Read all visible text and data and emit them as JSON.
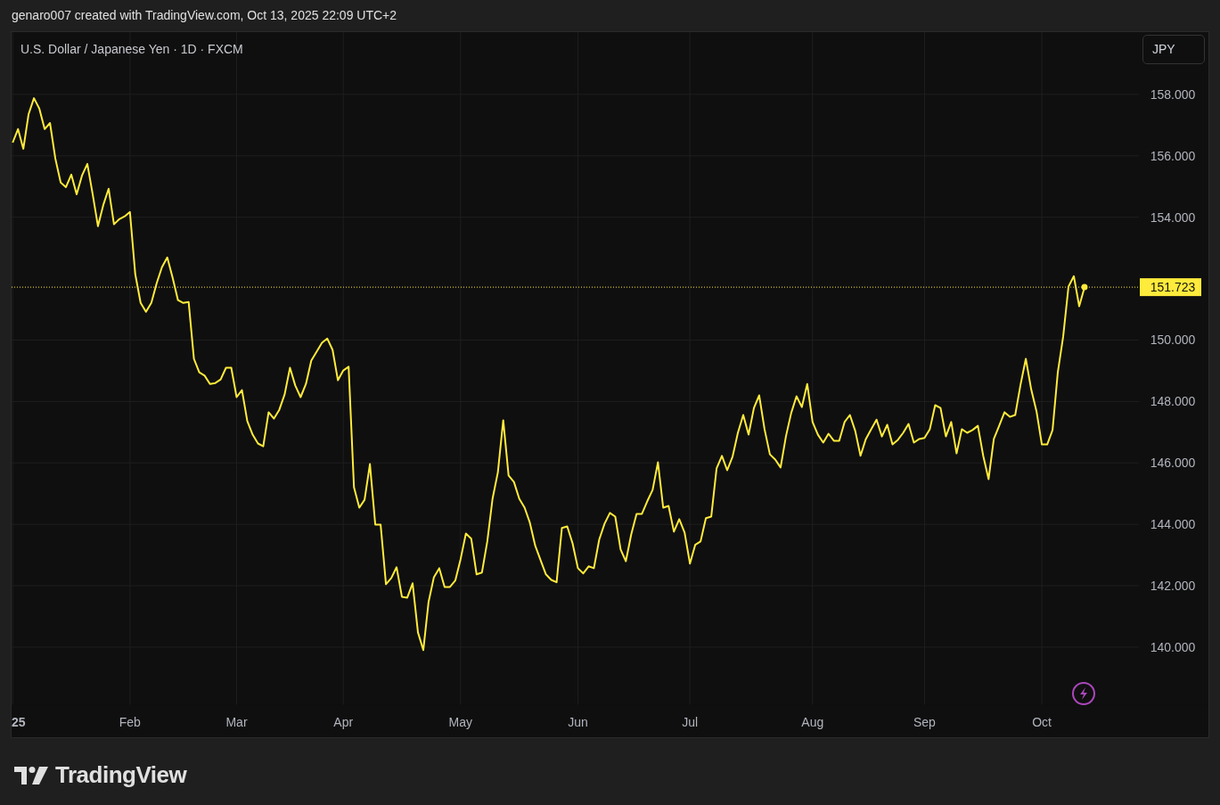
{
  "header": {
    "caption": "genaro007 created with TradingView.com, Oct 13, 2025 22:09 UTC+2"
  },
  "chart": {
    "symbol_title": "U.S. Dollar / Japanese Yen · 1D · FXCM",
    "currency_button": "JPY",
    "chart_data": {
      "type": "line",
      "grid": true,
      "ylim": [
        138.11,
        160.03
      ],
      "categories": [
        "25",
        null,
        null,
        null,
        null,
        null,
        null,
        null,
        null,
        null,
        null,
        null,
        null,
        null,
        null,
        null,
        null,
        null,
        null,
        null,
        null,
        null,
        "Feb",
        null,
        null,
        null,
        null,
        null,
        null,
        null,
        null,
        null,
        null,
        null,
        null,
        null,
        null,
        null,
        null,
        null,
        null,
        null,
        "Mar",
        null,
        null,
        null,
        null,
        null,
        null,
        null,
        null,
        null,
        null,
        null,
        null,
        null,
        null,
        null,
        null,
        null,
        null,
        null,
        "Apr",
        null,
        null,
        null,
        null,
        null,
        null,
        null,
        null,
        null,
        null,
        null,
        null,
        null,
        null,
        null,
        null,
        null,
        null,
        null,
        null,
        null,
        "May",
        null,
        null,
        null,
        null,
        null,
        null,
        null,
        null,
        null,
        null,
        null,
        null,
        null,
        null,
        null,
        null,
        null,
        null,
        null,
        null,
        null,
        "Jun",
        null,
        null,
        null,
        null,
        null,
        null,
        null,
        null,
        null,
        null,
        null,
        null,
        null,
        null,
        null,
        null,
        null,
        null,
        null,
        null,
        "Jul",
        null,
        null,
        null,
        null,
        null,
        null,
        null,
        null,
        null,
        null,
        null,
        null,
        null,
        null,
        null,
        null,
        null,
        null,
        null,
        null,
        null,
        null,
        "Aug",
        null,
        null,
        null,
        null,
        null,
        null,
        null,
        null,
        null,
        null,
        null,
        null,
        null,
        null,
        null,
        null,
        null,
        null,
        null,
        null,
        "Sep",
        null,
        null,
        null,
        null,
        null,
        null,
        null,
        null,
        null,
        null,
        null,
        null,
        null,
        null,
        null,
        null,
        null,
        null,
        null,
        null,
        null,
        "Oct",
        null,
        null,
        null,
        null,
        null,
        null,
        null,
        null
      ],
      "yticks": [
        {
          "value": 140,
          "label": "140.000"
        },
        {
          "value": 142,
          "label": "142.000"
        },
        {
          "value": 144,
          "label": "144.000"
        },
        {
          "value": 146,
          "label": "146.000"
        },
        {
          "value": 148,
          "label": "148.000"
        },
        {
          "value": 150,
          "label": "150.000"
        },
        {
          "value": 154,
          "label": "154.000"
        },
        {
          "value": 156,
          "label": "156.000"
        },
        {
          "value": 158,
          "label": "158.000"
        }
      ],
      "series": [
        {
          "color": "#ffeb3b",
          "values": [
            156.43,
            156.87,
            156.23,
            157.36,
            157.88,
            157.54,
            156.87,
            157.07,
            155.91,
            155.13,
            154.98,
            155.39,
            154.75,
            155.36,
            155.74,
            154.75,
            153.71,
            154.4,
            154.93,
            153.77,
            153.94,
            154.03,
            154.17,
            152.14,
            151.21,
            150.92,
            151.21,
            151.85,
            152.37,
            152.69,
            152.03,
            151.3,
            151.21,
            151.24,
            149.39,
            148.95,
            148.84,
            148.57,
            148.6,
            148.72,
            149.1,
            149.1,
            148.14,
            148.37,
            147.36,
            146.92,
            146.63,
            146.54,
            147.65,
            147.44,
            147.73,
            148.23,
            149.1,
            148.52,
            148.14,
            148.57,
            149.33,
            149.62,
            149.91,
            150.05,
            149.68,
            148.69,
            149.01,
            149.13,
            145.21,
            144.54,
            144.8,
            145.96,
            143.99,
            143.99,
            142.05,
            142.25,
            142.6,
            141.64,
            141.61,
            142.08,
            140.48,
            139.9,
            141.47,
            142.28,
            142.57,
            141.96,
            141.96,
            142.17,
            142.86,
            143.7,
            143.53,
            142.37,
            142.43,
            143.44,
            144.83,
            145.7,
            147.39,
            145.59,
            145.38,
            144.83,
            144.54,
            144.05,
            143.3,
            142.83,
            142.37,
            142.19,
            142.11,
            143.88,
            143.93,
            143.38,
            142.57,
            142.4,
            142.63,
            142.57,
            143.5,
            144.02,
            144.37,
            144.25,
            143.18,
            142.8,
            143.67,
            144.34,
            144.34,
            144.75,
            145.12,
            146.02,
            144.54,
            144.6,
            143.76,
            144.17,
            143.73,
            142.72,
            143.33,
            143.44,
            144.2,
            144.25,
            145.82,
            146.23,
            145.76,
            146.2,
            146.98,
            147.56,
            146.92,
            147.79,
            148.2,
            147.1,
            146.28,
            146.11,
            145.85,
            146.86,
            147.62,
            148.17,
            147.82,
            148.57,
            147.33,
            146.92,
            146.66,
            146.95,
            146.72,
            146.72,
            147.33,
            147.56,
            147.04,
            146.23,
            146.78,
            147.1,
            147.41,
            146.86,
            147.24,
            146.6,
            146.75,
            146.98,
            147.27,
            146.66,
            146.78,
            146.81,
            147.1,
            147.88,
            147.79,
            146.86,
            147.33,
            146.31,
            147.1,
            146.98,
            147.07,
            147.21,
            146.23,
            145.47,
            146.78,
            147.21,
            147.65,
            147.5,
            147.56,
            148.55,
            149.39,
            148.4,
            147.68,
            146.6,
            146.6,
            147.07,
            148.95,
            150.11,
            151.74,
            152.08,
            151.1,
            151.72
          ]
        }
      ],
      "ref_lines": [
        {
          "axis": "y",
          "value": 151.723,
          "label": "151.723"
        }
      ]
    }
  },
  "footer": {
    "brand": "TradingView"
  }
}
